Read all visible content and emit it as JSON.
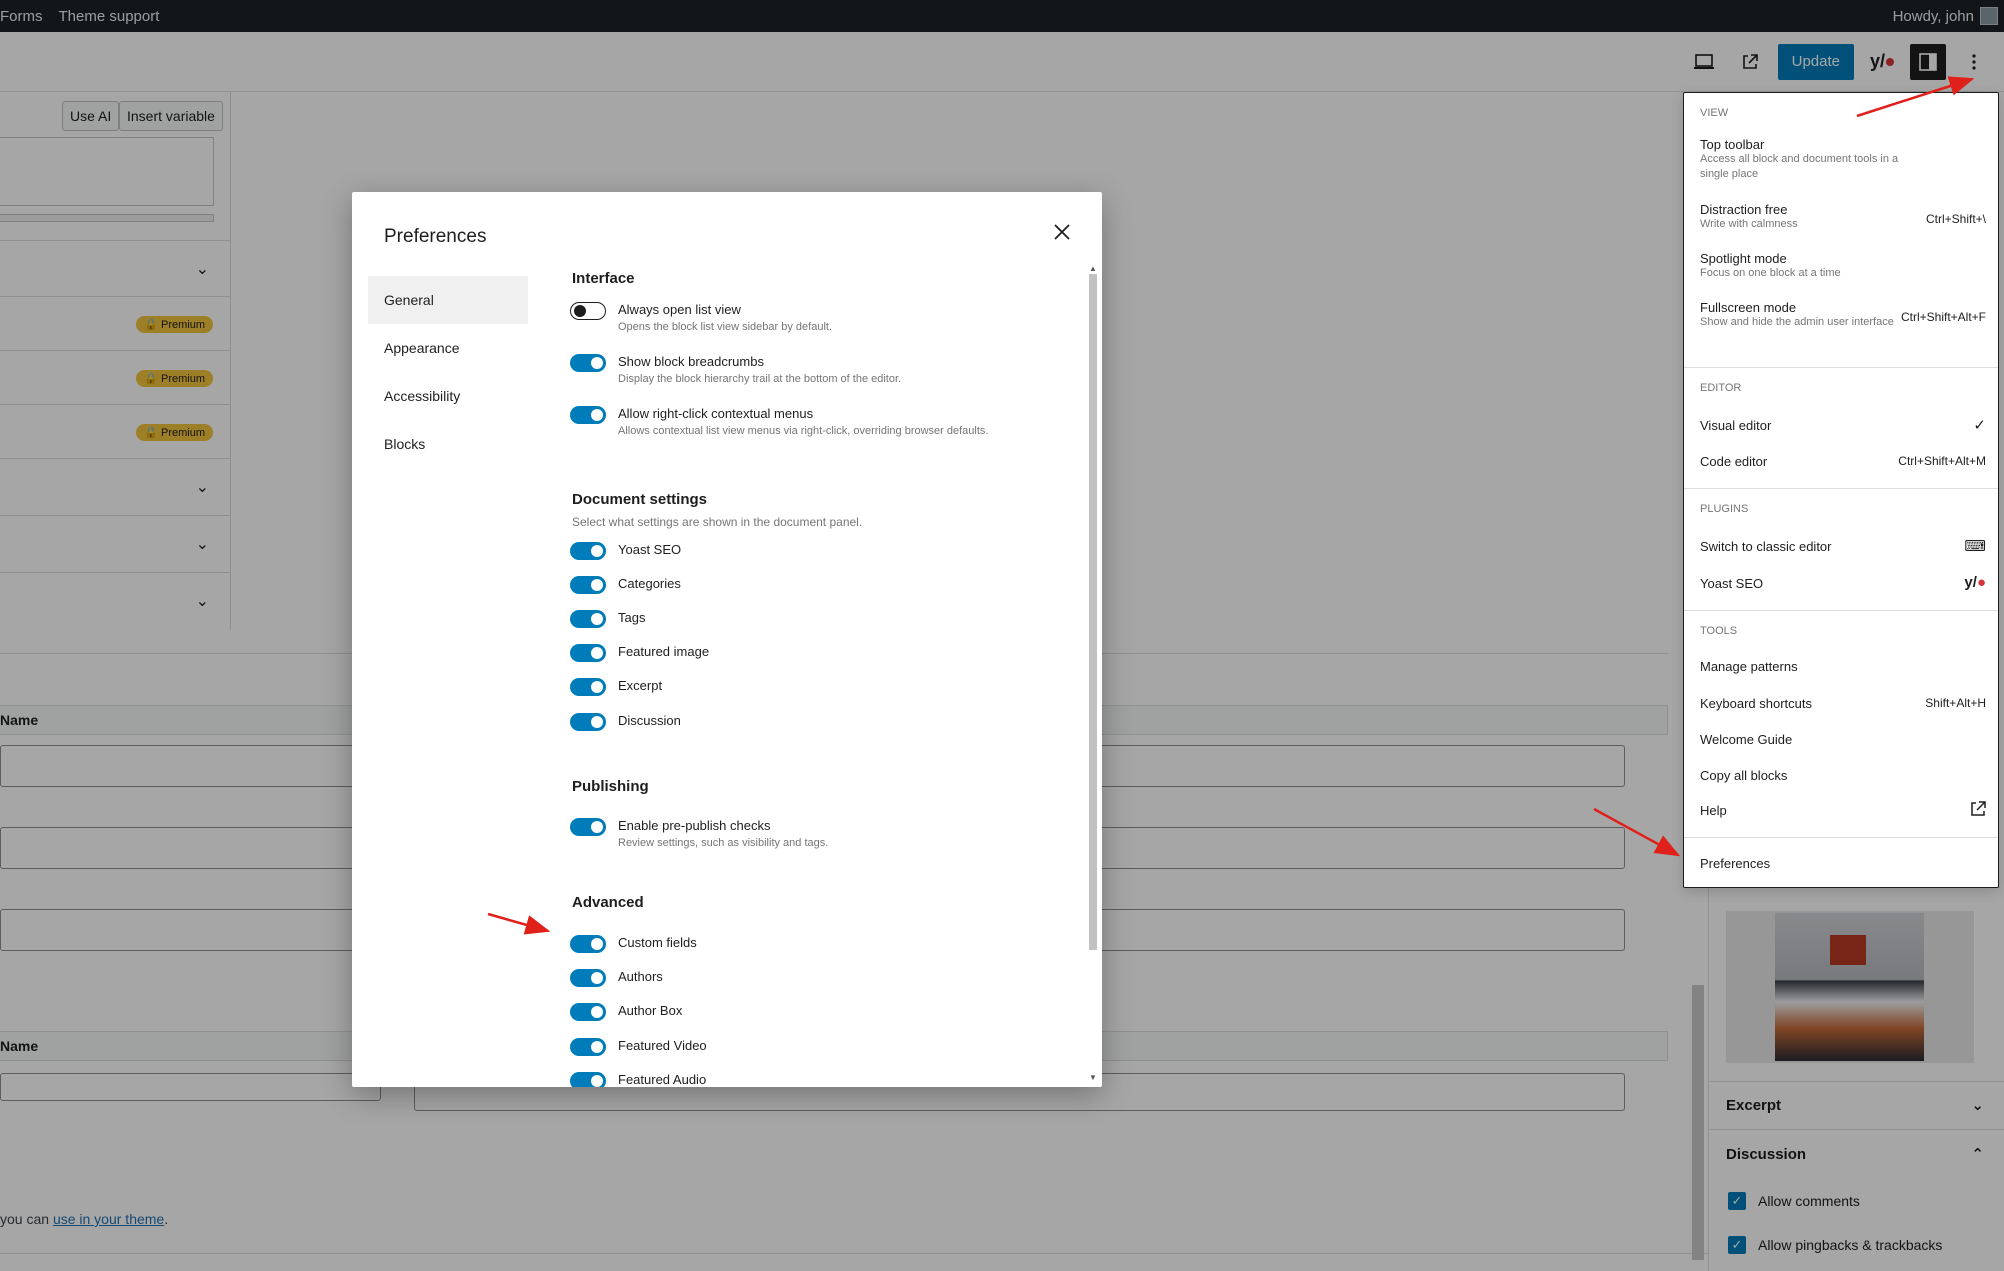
{
  "adminbar": {
    "left_items": [
      "Forms",
      "Theme support"
    ],
    "right_text": "Howdy, john"
  },
  "header": {
    "update_label": "Update",
    "yoast_label": "y/"
  },
  "background": {
    "use_ai": "Use AI",
    "insert_variable": "Insert variable",
    "premium": "Premium",
    "name_header": "Name",
    "name_header_2": "Name",
    "footer_text_prefix": "you can ",
    "footer_link": "use in your theme",
    "footer_text_suffix": "."
  },
  "sidebar": {
    "excerpt": "Excerpt",
    "discussion": "Discussion",
    "allow_comments": "Allow comments",
    "allow_pingbacks": "Allow pingbacks & trackbacks"
  },
  "modal": {
    "title": "Preferences",
    "nav": [
      "General",
      "Appearance",
      "Accessibility",
      "Blocks"
    ],
    "interface": {
      "title": "Interface",
      "always_open_list": "Always open list view",
      "always_open_list_help": "Opens the block list view sidebar by default.",
      "breadcrumbs": "Show block breadcrumbs",
      "breadcrumbs_help": "Display the block hierarchy trail at the bottom of the editor.",
      "right_click": "Allow right-click contextual menus",
      "right_click_help": "Allows contextual list view menus via right-click, overriding browser defaults."
    },
    "document": {
      "title": "Document settings",
      "desc": "Select what settings are shown in the document panel.",
      "items": [
        "Yoast SEO",
        "Categories",
        "Tags",
        "Featured image",
        "Excerpt",
        "Discussion"
      ]
    },
    "publishing": {
      "title": "Publishing",
      "prepublish": "Enable pre-publish checks",
      "prepublish_help": "Review settings, such as visibility and tags."
    },
    "advanced": {
      "title": "Advanced",
      "items": [
        "Custom fields",
        "Authors",
        "Author Box",
        "Featured Video",
        "Featured Audio"
      ]
    }
  },
  "menu": {
    "view": {
      "title": "View",
      "top_toolbar": "Top toolbar",
      "top_toolbar_help": "Access all block and document tools in a single place",
      "distraction_free": "Distraction free",
      "distraction_free_help": "Write with calmness",
      "distraction_free_shortcut": "Ctrl+Shift+\\",
      "spotlight": "Spotlight mode",
      "spotlight_help": "Focus on one block at a time",
      "fullscreen": "Fullscreen mode",
      "fullscreen_help": "Show and hide the admin user interface",
      "fullscreen_shortcut": "Ctrl+Shift+Alt+F"
    },
    "editor": {
      "title": "Editor",
      "visual": "Visual editor",
      "visual_check": "✓",
      "code": "Code editor",
      "code_shortcut": "Ctrl+Shift+Alt+M"
    },
    "plugins": {
      "title": "Plugins",
      "classic": "Switch to classic editor",
      "yoast": "Yoast SEO"
    },
    "tools": {
      "title": "Tools",
      "patterns": "Manage patterns",
      "shortcuts": "Keyboard shortcuts",
      "shortcuts_shortcut": "Shift+Alt+H",
      "welcome": "Welcome Guide",
      "copy_blocks": "Copy all blocks",
      "help": "Help"
    },
    "preferences": "Preferences"
  }
}
